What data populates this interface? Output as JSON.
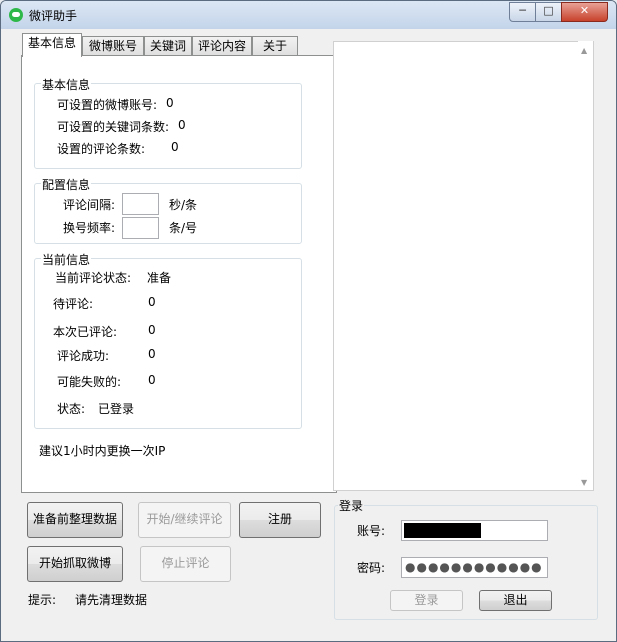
{
  "window": {
    "title": "微评助手",
    "min": "─",
    "max": "□",
    "close": "✕"
  },
  "tabs": [
    {
      "label": "基本信息"
    },
    {
      "label": "微博账号"
    },
    {
      "label": "关键词"
    },
    {
      "label": "评论内容"
    },
    {
      "label": "关于"
    }
  ],
  "basic_info": {
    "group_title": "基本信息",
    "weibo_accounts_label": "可设置的微博账号:",
    "weibo_accounts_value": "0",
    "keywords_label": "可设置的关键词条数:",
    "keywords_value": "0",
    "comments_label": "设置的评论条数:",
    "comments_value": "0"
  },
  "config": {
    "group_title": "配置信息",
    "interval_label": "评论间隔:",
    "interval_value": "",
    "interval_unit": "秒/条",
    "switch_label": "换号频率:",
    "switch_value": "",
    "switch_unit": "条/号"
  },
  "current": {
    "group_title": "当前信息",
    "state_label": "当前评论状态:",
    "state_value": "准备",
    "pending_label": "待评论:",
    "pending_value": "0",
    "done_label": "本次已评论:",
    "done_value": "0",
    "success_label": "评论成功:",
    "success_value": "0",
    "fail_label": "可能失败的:",
    "fail_value": "0",
    "status_label": "状态:",
    "status_value": "已登录"
  },
  "tip_ip": "建议1小时内更换一次IP",
  "buttons": {
    "prepare": "准备前整理数据",
    "start_continue": "开始/继续评论",
    "register": "注册",
    "fetch": "开始抓取微博",
    "stop": "停止评论"
  },
  "hint": {
    "label": "提示:",
    "text": "请先清理数据"
  },
  "login": {
    "title": "登录",
    "account_label": "账号:",
    "password_label": "密码:",
    "password_mask": "●●●●●●●●●●●●",
    "login_button": "登录",
    "exit_button": "退出"
  }
}
